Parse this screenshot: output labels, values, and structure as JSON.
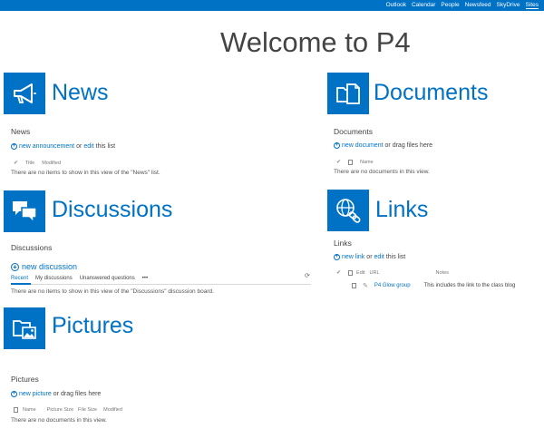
{
  "suite_nav": [
    "Outlook",
    "Calendar",
    "People",
    "Newsfeed",
    "SkyDrive",
    "Sites"
  ],
  "page_title": "Welcome to P4",
  "news": {
    "tile_title": "News",
    "label": "News",
    "new_link": "new announcement",
    "or_text": "or",
    "edit_link": "edit",
    "edit_suffix": "this list",
    "columns": [
      "Title",
      "Modified"
    ],
    "empty": "There are no items to show in this view of the \"News\" list."
  },
  "documents": {
    "tile_title": "Documents",
    "label": "Documents",
    "new_link": "new document",
    "suffix": "or drag files here",
    "columns": [
      "Name"
    ],
    "empty": "There are no documents in this view."
  },
  "discussions": {
    "tile_title": "Discussions",
    "label": "Discussions",
    "new_link": "new discussion",
    "tabs": [
      "Recent",
      "My discussions",
      "Unanswered questions",
      "•••"
    ],
    "empty": "There are no items to show in this view of the \"Discussions\" discussion board."
  },
  "links": {
    "tile_title": "Links",
    "label": "Links",
    "new_link": "new link",
    "or_text": "or",
    "edit_link": "edit",
    "edit_suffix": "this list",
    "columns": [
      "Edit",
      "URL",
      "Notes"
    ],
    "rows": [
      {
        "url": "P4 Glow group",
        "notes": "This includes the link to the class blog"
      }
    ]
  },
  "pictures": {
    "tile_title": "Pictures",
    "label": "Pictures",
    "new_link": "new picture",
    "suffix": "or drag files here",
    "columns": [
      "Name",
      "Picture Size",
      "File Size",
      "Modified"
    ],
    "empty": "There are no documents in this view."
  },
  "colors": {
    "brand": "#0072c6",
    "text": "#444444"
  },
  "icons": {
    "news": "megaphone-icon",
    "documents": "folder-document-icon",
    "discussions": "speech-bubbles-icon",
    "links": "globe-chain-icon",
    "pictures": "folder-picture-icon"
  }
}
